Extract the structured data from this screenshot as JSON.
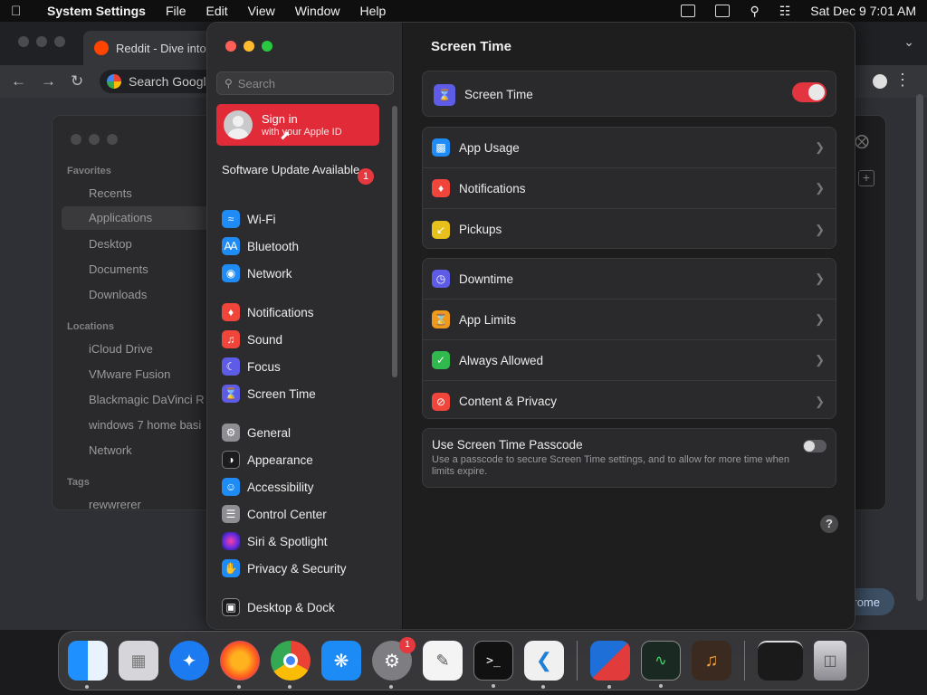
{
  "menubar": {
    "app_name": "System Settings",
    "menus": [
      "File",
      "Edit",
      "View",
      "Window",
      "Help"
    ],
    "datetime": "Sat Dec 9  7:01 AM"
  },
  "chrome": {
    "tab_title": "Reddit - Dive into",
    "omnibox_placeholder": "Search Googl",
    "pill_text": "rome"
  },
  "finder": {
    "favorites_heading": "Favorites",
    "favorites": [
      "Recents",
      "Applications",
      "Desktop",
      "Documents",
      "Downloads"
    ],
    "locations_heading": "Locations",
    "locations": [
      "iCloud Drive",
      "VMware Fusion",
      "Blackmagic DaVinci R",
      "windows 7 home basi",
      "Network"
    ],
    "tags_heading": "Tags",
    "tags": [
      "rewwrerer"
    ]
  },
  "settings": {
    "search_placeholder": "Search",
    "signin": {
      "title": "Sign in",
      "subtitle": "with your Apple ID"
    },
    "software_update": {
      "label": "Software Update Available",
      "badge": "1"
    },
    "nav": [
      {
        "label": "Wi-Fi",
        "icon": "wifi-icon",
        "color": "#1f8cf5"
      },
      {
        "label": "Bluetooth",
        "icon": "bluetooth-icon",
        "color": "#1f8cf5"
      },
      {
        "label": "Network",
        "icon": "globe-icon",
        "color": "#1f8cf5"
      },
      {
        "label": "Notifications",
        "icon": "bell-icon",
        "color": "#f0453a"
      },
      {
        "label": "Sound",
        "icon": "speaker-icon",
        "color": "#f0453a"
      },
      {
        "label": "Focus",
        "icon": "moon-icon",
        "color": "#5e5ce6"
      },
      {
        "label": "Screen Time",
        "icon": "hourglass-icon",
        "color": "#5e5ce6"
      },
      {
        "label": "General",
        "icon": "gear-icon",
        "color": "#8e8e93"
      },
      {
        "label": "Appearance",
        "icon": "appearance-icon",
        "color": "#1c1c1e"
      },
      {
        "label": "Accessibility",
        "icon": "accessibility-icon",
        "color": "#1f8cf5"
      },
      {
        "label": "Control Center",
        "icon": "control-center-icon",
        "color": "#8e8e93"
      },
      {
        "label": "Siri & Spotlight",
        "icon": "siri-icon",
        "color": "#7a3fe0"
      },
      {
        "label": "Privacy & Security",
        "icon": "hand-icon",
        "color": "#1f8cf5"
      },
      {
        "label": "Desktop & Dock",
        "icon": "dock-icon",
        "color": "#1c1c1e"
      }
    ],
    "pane_title": "Screen Time",
    "main_toggle_label": "Screen Time",
    "group1": [
      {
        "label": "App Usage",
        "icon": "chart-icon",
        "color": "#1f8cf5"
      },
      {
        "label": "Notifications",
        "icon": "bell-icon",
        "color": "#f0453a"
      },
      {
        "label": "Pickups",
        "icon": "pickups-icon",
        "color": "#e8c01c"
      }
    ],
    "group2": [
      {
        "label": "Downtime",
        "icon": "downtime-icon",
        "color": "#5e5ce6"
      },
      {
        "label": "App Limits",
        "icon": "hourglass-icon",
        "color": "#f09a1c"
      },
      {
        "label": "Always Allowed",
        "icon": "checkmark-icon",
        "color": "#30b94c"
      },
      {
        "label": "Content & Privacy",
        "icon": "restricted-icon",
        "color": "#f0453a"
      }
    ],
    "passcode": {
      "title": "Use Screen Time Passcode",
      "description": "Use a passcode to secure Screen Time settings, and to allow for more time when limits expire."
    },
    "help_label": "?"
  },
  "dock": {
    "settings_badge": "1",
    "apps": [
      "Finder",
      "Launchpad",
      "Safari",
      "Firefox",
      "Chrome",
      "App Store",
      "System Settings",
      "TextEdit",
      "Terminal",
      "VS Code",
      "VMware Fusion",
      "Activity Monitor",
      "GarageBand",
      "Window",
      "Trash"
    ]
  }
}
